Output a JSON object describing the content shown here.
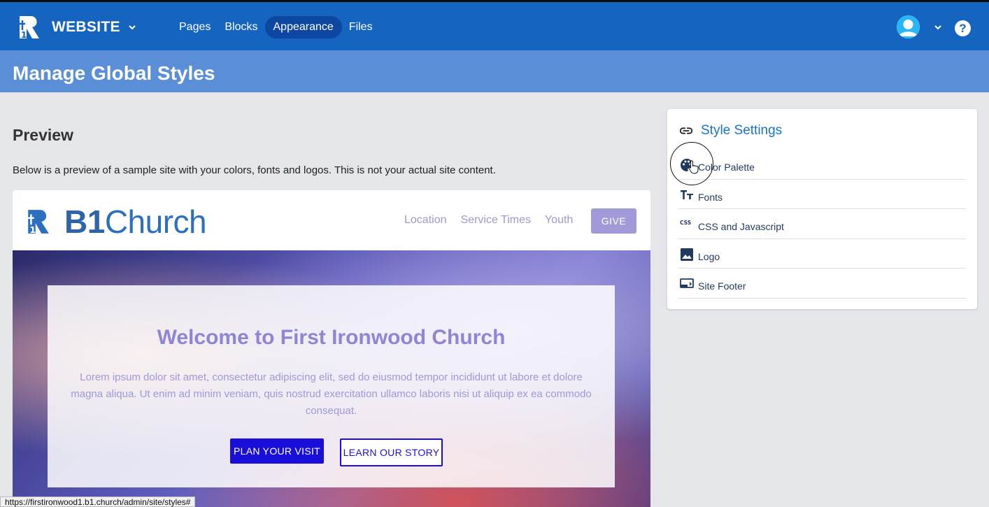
{
  "topbar": {
    "site_name": "WEBSITE",
    "nav": [
      "Pages",
      "Blocks",
      "Appearance",
      "Files"
    ],
    "active_nav": "Appearance",
    "help_label": "?"
  },
  "page": {
    "title": "Manage Global Styles"
  },
  "preview": {
    "heading": "Preview",
    "description": "Below is a preview of a sample site with your colors, fonts and logos. This is not your actual site content.",
    "site": {
      "logo_text_bold": "B1",
      "logo_text": "Church",
      "nav": [
        "Location",
        "Service Times",
        "Youth"
      ],
      "give_label": "GIVE",
      "hero_title": "Welcome to First Ironwood Church",
      "hero_text": "Lorem ipsum dolor sit amet, consectetur adipiscing elit, sed do eiusmod tempor incididunt ut labore et dolore magna aliqua. Ut enim ad minim veniam, quis nostrud exercitation ullamco laboris nisi ut aliquip ex ea commodo consequat.",
      "primary_button": "PLAN YOUR VISIT",
      "secondary_button": "LEARN OUR STORY"
    }
  },
  "style_settings": {
    "title": "Style Settings",
    "items": [
      {
        "label": "Color Palette",
        "icon": "palette-icon"
      },
      {
        "label": "Fonts",
        "icon": "font-size-icon"
      },
      {
        "label": "CSS and Javascript",
        "icon": "css-icon"
      },
      {
        "label": "Logo",
        "icon": "image-icon"
      },
      {
        "label": "Site Footer",
        "icon": "footer-icon"
      }
    ]
  },
  "status_bar": {
    "url": "https://firstironwood1.b1.church/admin/site/styles#"
  },
  "colors": {
    "topbar": "#1565c0",
    "titlebar": "#5a8fd8",
    "accent": "#1a73c7",
    "preview_primary": "#1a0fd8",
    "preview_secondary": "#9b98d6"
  }
}
